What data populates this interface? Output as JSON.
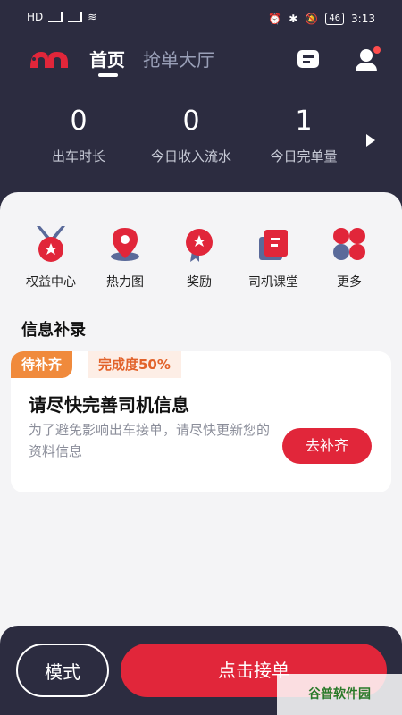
{
  "status_bar": {
    "time": "3:13",
    "battery": "46",
    "left_labels": [
      "HD",
      "HD"
    ]
  },
  "nav": {
    "tabs": [
      {
        "label": "首页"
      },
      {
        "label": "抢单大厅"
      }
    ]
  },
  "stats": [
    {
      "value": "0",
      "label": "出车时长"
    },
    {
      "value": "0",
      "label": "今日收入流水"
    },
    {
      "value": "1",
      "label": "今日完单量"
    }
  ],
  "quick_links": [
    {
      "label": "权益中心",
      "icon": "medal-icon"
    },
    {
      "label": "热力图",
      "icon": "map-pin-icon"
    },
    {
      "label": "奖励",
      "icon": "reward-icon"
    },
    {
      "label": "司机课堂",
      "icon": "book-icon"
    },
    {
      "label": "更多",
      "icon": "more-icon"
    }
  ],
  "info_section": {
    "title": "信息补录",
    "tag": "待补齐",
    "progress_label": "完成度50%",
    "card_title": "请尽快完善司机信息",
    "card_desc": "为了避免影响出车接单，请尽快更新您的资料信息",
    "button_label": "去补齐"
  },
  "bottom_bar": {
    "mode_label": "模式",
    "grab_label": "点击接单"
  },
  "watermark": "谷普软件园",
  "colors": {
    "header_bg": "#2c2c40",
    "accent": "#e1263a",
    "tag_orange": "#f08a3c"
  }
}
